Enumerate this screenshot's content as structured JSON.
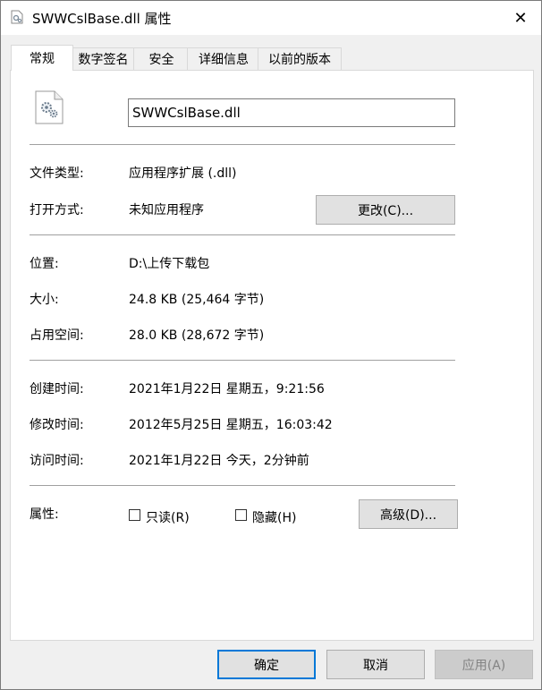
{
  "window": {
    "title": "SWWCslBase.dll 属性",
    "close_glyph": "✕"
  },
  "tabs": [
    {
      "label": "常规",
      "active": true
    },
    {
      "label": "数字签名",
      "active": false
    },
    {
      "label": "安全",
      "active": false
    },
    {
      "label": "详细信息",
      "active": false
    },
    {
      "label": "以前的版本",
      "active": false
    }
  ],
  "general": {
    "file_name": "SWWCslBase.dll",
    "file_type_label": "文件类型:",
    "file_type_value": "应用程序扩展 (.dll)",
    "open_with_label": "打开方式:",
    "open_with_value": "未知应用程序",
    "change_button": "更改(C)...",
    "location_label": "位置:",
    "location_value": "D:\\上传下载包",
    "size_label": "大小:",
    "size_value": "24.8 KB (25,464 字节)",
    "size_on_disk_label": "占用空间:",
    "size_on_disk_value": "28.0 KB (28,672 字节)",
    "created_label": "创建时间:",
    "created_value": "2021年1月22日 星期五，9:21:56",
    "modified_label": "修改时间:",
    "modified_value": "2012年5月25日 星期五，16:03:42",
    "accessed_label": "访问时间:",
    "accessed_value": "2021年1月22日 今天，2分钟前",
    "attributes_label": "属性:",
    "readonly_label": "只读(R)",
    "readonly_checked": false,
    "hidden_label": "隐藏(H)",
    "hidden_checked": false,
    "advanced_button": "高级(D)..."
  },
  "footer": {
    "ok": "确定",
    "cancel": "取消",
    "apply": "应用(A)"
  },
  "colors": {
    "accent": "#0078d7",
    "panel": "#ffffff",
    "window": "#f0f0f0"
  }
}
